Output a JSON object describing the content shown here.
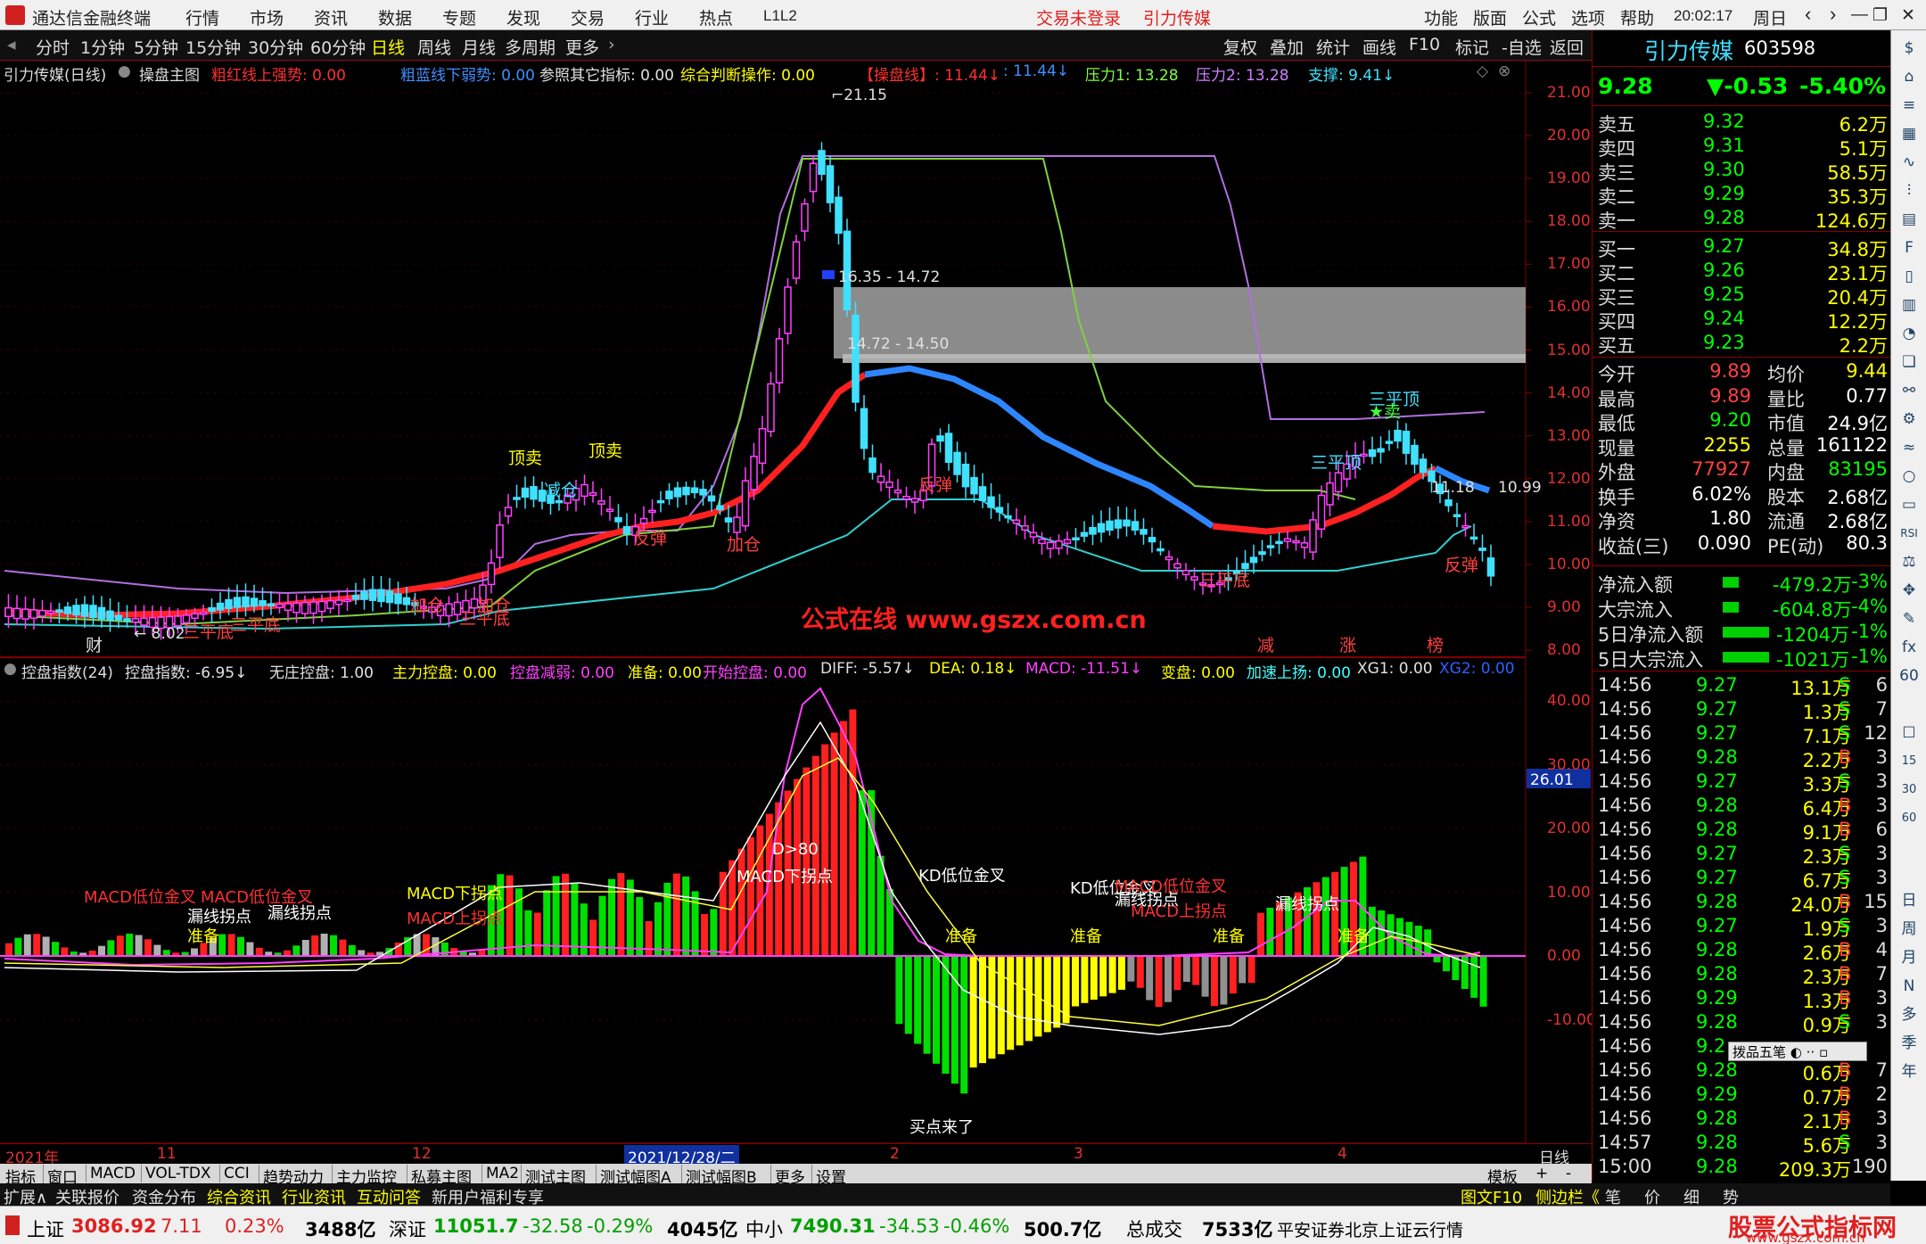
{
  "app": {
    "title": "通达信金融终端",
    "menus": [
      "行情",
      "市场",
      "资讯",
      "数据",
      "专题",
      "发现",
      "交易",
      "行业",
      "热点",
      "L1L2"
    ],
    "center_links": [
      "交易未登录",
      "引力传媒"
    ],
    "right_menus": [
      "功能",
      "版面",
      "公式",
      "选项",
      "帮助"
    ],
    "time": "20:02:17",
    "weekday": "周日"
  },
  "toolbar": {
    "periods": [
      "分时",
      "1分钟",
      "5分钟",
      "15分钟",
      "30分钟",
      "60分钟",
      "日线",
      "周线",
      "月线",
      "多周期",
      "更多"
    ],
    "active": "日线",
    "right": [
      "复权",
      "叠加",
      "统计",
      "画线",
      "F10",
      "标记",
      "-自选",
      "返回"
    ]
  },
  "main_header": {
    "name": "引力传媒(日线)",
    "indicator": "操盘主图",
    "items": [
      {
        "t": "粗红线上强势: 0.00",
        "c": "#ff3030"
      },
      {
        "t": "粗蓝线下弱势: 0.00",
        "c": "#3f8fff"
      },
      {
        "t": "参照其它指标: 0.00",
        "c": "#e0e0e0"
      },
      {
        "t": "综合判断操作: 0.00",
        "c": "#ffff00"
      },
      {
        "t": "【操盘线】: 11.44↓",
        "c": "#ff3030"
      },
      {
        "t": ": 11.44↓",
        "c": "#3f8fff"
      },
      {
        "t": "压力1: 13.28",
        "c": "#80ff40"
      },
      {
        "t": "压力2: 13.28",
        "c": "#d080ff"
      },
      {
        "t": "支撑: 9.41↓",
        "c": "#40e0ff"
      }
    ]
  },
  "sub_header": {
    "name": "控盘指数(24)",
    "items": [
      {
        "t": "控盘指数: -6.95↓",
        "c": "#e0e0e0"
      },
      {
        "t": "无庄控盘: 1.00",
        "c": "#e0e0e0"
      },
      {
        "t": "主力控盘: 0.00",
        "c": "#ffff00"
      },
      {
        "t": "控盘减弱: 0.00",
        "c": "#ff40ff"
      },
      {
        "t": "准备: 0.00",
        "c": "#ffff00"
      },
      {
        "t": "开始控盘: 0.00",
        "c": "#ff40ff"
      },
      {
        "t": "DIFF: -5.57↓",
        "c": "#e0e0e0"
      },
      {
        "t": "DEA: 0.18↓",
        "c": "#ffff00"
      },
      {
        "t": "MACD: -11.51↓",
        "c": "#ff40ff"
      },
      {
        "t": "变盘: 0.00",
        "c": "#ffff00"
      },
      {
        "t": "加速上扬: 0.00",
        "c": "#40ffff"
      },
      {
        "t": "XG1: 0.00",
        "c": "#e0e0e0"
      },
      {
        "t": "XG2: 0.00",
        "c": "#3060ff"
      }
    ]
  },
  "price_axis": [
    "21.00",
    "20.00",
    "19.00",
    "18.00",
    "17.00",
    "16.00",
    "15.00",
    "14.00",
    "13.00",
    "12.00",
    "11.00",
    "10.00",
    "9.00",
    "8.00"
  ],
  "ind_axis": [
    "40.00",
    "30.00",
    "20.00",
    "10.00",
    "0.00",
    "-10.00"
  ],
  "ind_marker": "26.01",
  "date_axis": [
    "2021年",
    "11",
    "12",
    "2021/12/28/二",
    "2",
    "3",
    "4",
    "日线"
  ],
  "annotations": {
    "high": "21.15",
    "low": "8.02",
    "zone1": "16.35 - 14.72",
    "zone2": "14.72 - 14.50",
    "right_val1": "11.18",
    "right_val2": "10.99",
    "watermark": "公式在线  www.gszx.com.cn",
    "labels": [
      "顶卖",
      "顶卖",
      "减仓",
      "加仓",
      "加仓",
      "三平底",
      "三平底",
      "三平底",
      "三平底",
      "三平顶",
      "三平顶",
      "反弹",
      "反弹",
      "反弹",
      "加仓",
      "★卖",
      "财",
      "减",
      "涨",
      "榜"
    ],
    "ind_labels": [
      "MACD低位金叉",
      "MACD低位金叉",
      "漏线拐点",
      "漏线拐点",
      "准备",
      "MACD下拐点",
      "MACD上拐点",
      "MACD下拐点",
      "D>80",
      "KD低位金叉",
      "KD低位金叉",
      "MACD低位金叉",
      "MACD上拐点",
      "漏线拐点",
      "漏线拐点",
      "准备",
      "准备",
      "准备",
      "准备",
      "买点来了"
    ]
  },
  "quote": {
    "name": "引力传媒",
    "code": "603598",
    "price": "9.28",
    "change": "▼-0.53",
    "pct": "-5.40%",
    "asks": [
      [
        "卖五",
        "9.32",
        "6.2万"
      ],
      [
        "卖四",
        "9.31",
        "5.1万"
      ],
      [
        "卖三",
        "9.30",
        "58.5万"
      ],
      [
        "卖二",
        "9.29",
        "35.3万"
      ],
      [
        "卖一",
        "9.28",
        "124.6万"
      ]
    ],
    "bids": [
      [
        "买一",
        "9.27",
        "34.8万"
      ],
      [
        "买二",
        "9.26",
        "23.1万"
      ],
      [
        "买三",
        "9.25",
        "20.4万"
      ],
      [
        "买四",
        "9.24",
        "12.2万"
      ],
      [
        "买五",
        "9.23",
        "2.2万"
      ]
    ],
    "stats": [
      [
        "今开",
        "9.89",
        "均价",
        "9.44"
      ],
      [
        "最高",
        "9.89",
        "量比",
        "0.77"
      ],
      [
        "最低",
        "9.20",
        "市值",
        "24.9亿"
      ],
      [
        "现量",
        "2255",
        "总量",
        "161122"
      ],
      [
        "外盘",
        "77927",
        "内盘",
        "83195"
      ],
      [
        "换手",
        "6.02%",
        "股本",
        "2.68亿"
      ],
      [
        "净资",
        "1.80",
        "流通",
        "2.68亿"
      ],
      [
        "收益(三)",
        "0.090",
        "PE(动)",
        "80.3"
      ]
    ],
    "flows": [
      [
        "净流入额",
        "-479.2万",
        "-3%"
      ],
      [
        "大宗流入",
        "-604.8万",
        "-4%"
      ],
      [
        "5日净流入额",
        "-1204万",
        "-1%"
      ],
      [
        "5日大宗流入",
        "-1021万",
        "-1%"
      ]
    ],
    "ticks": [
      [
        "14:56",
        "9.27",
        "13.1万",
        "S",
        "6"
      ],
      [
        "14:56",
        "9.27",
        "1.3万",
        "S",
        "7"
      ],
      [
        "14:56",
        "9.27",
        "7.1万",
        "S",
        "12"
      ],
      [
        "14:56",
        "9.28",
        "2.2万",
        "B",
        "3"
      ],
      [
        "14:56",
        "9.27",
        "3.3万",
        "S",
        "3"
      ],
      [
        "14:56",
        "9.28",
        "6.4万",
        "B",
        "3"
      ],
      [
        "14:56",
        "9.28",
        "9.1万",
        "B",
        "6"
      ],
      [
        "14:56",
        "9.27",
        "2.3万",
        "S",
        "3"
      ],
      [
        "14:56",
        "9.27",
        "6.7万",
        "S",
        "3"
      ],
      [
        "14:56",
        "9.28",
        "24.0万",
        "B",
        "15"
      ],
      [
        "14:56",
        "9.27",
        "1.9万",
        "S",
        "3"
      ],
      [
        "14:56",
        "9.28",
        "2.6万",
        "B",
        "4"
      ],
      [
        "14:56",
        "9.28",
        "2.3万",
        "B",
        "7"
      ],
      [
        "14:56",
        "9.29",
        "1.3万",
        "B",
        "3"
      ],
      [
        "14:56",
        "9.28",
        "0.9万",
        "S",
        "3"
      ],
      [
        "14:56",
        "9.2",
        "",
        "",
        " "
      ],
      [
        "14:56",
        "9.28",
        "0.6万",
        "B",
        "7"
      ],
      [
        "14:56",
        "9.29",
        "0.7万",
        "B",
        "2"
      ],
      [
        "14:56",
        "9.28",
        "2.1万",
        "B",
        "3"
      ],
      [
        "14:57",
        "9.28",
        "5.6万",
        "S",
        "3"
      ],
      [
        "15:00",
        "9.28",
        "209.3万",
        "",
        "190"
      ]
    ],
    "popup": "拨品五笔"
  },
  "sidebar": {
    "icons": [
      "日",
      "周",
      "月",
      "N",
      "多",
      "季",
      "年"
    ]
  },
  "bottom_tabs": [
    "指标",
    "窗口",
    "MACD",
    "VOL-TDX",
    "CCI",
    "趋势动力",
    "主力监控",
    "私募主图",
    "MA2",
    "测试主图",
    "测试幅图A",
    "测试幅图B",
    "更多",
    "设置"
  ],
  "bottom_right": [
    "模板",
    "+",
    "-"
  ],
  "tabs2": [
    {
      "t": "扩展∧",
      "c": "#e0e0e0"
    },
    {
      "t": "关联报价",
      "c": "#e0e0e0"
    },
    {
      "t": "资金分布",
      "c": "#e0e0e0"
    },
    {
      "t": "综合资讯",
      "c": "#ffff00"
    },
    {
      "t": "行业资讯",
      "c": "#ffff00"
    },
    {
      "t": "互动问答",
      "c": "#ffff00"
    },
    {
      "t": "新用户福利专享",
      "c": "#e0e0e0"
    }
  ],
  "tabs2_right": [
    "图文F10",
    "侧边栏《",
    "笔",
    "价",
    "细",
    "势"
  ],
  "status": {
    "items": [
      [
        "上证",
        "3086.92",
        "7.11",
        "0.23%",
        "3488亿"
      ],
      [
        "深证",
        "11051.7",
        "-32.58",
        "-0.29%",
        "4045亿"
      ],
      [
        "中小",
        "7490.31",
        "-34.53",
        "-0.46%",
        "500.7亿"
      ]
    ],
    "total_label": "总成交",
    "total": "7533亿",
    "broker": "平安证券北京上证云行情",
    "brand": "股票公式指标网",
    "brand_url": "www.gszx.com.cn"
  }
}
